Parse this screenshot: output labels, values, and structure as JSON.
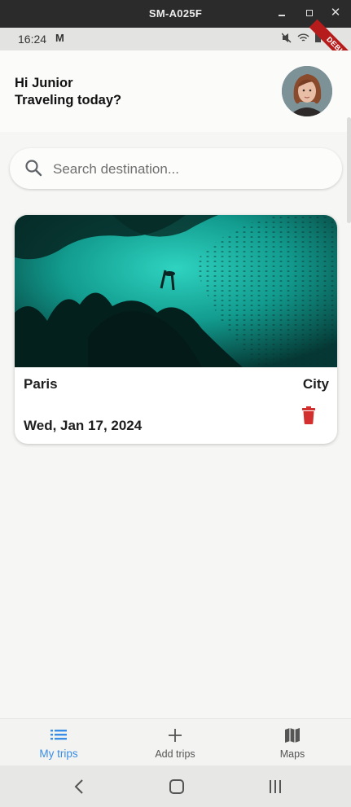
{
  "window": {
    "title": "SM-A025F"
  },
  "status_bar": {
    "time": "16:24",
    "mail_icon": "M",
    "debug_label": "DEBUG"
  },
  "header": {
    "greeting_line1": "Hi Junior",
    "greeting_line2": "Traveling today?"
  },
  "search": {
    "placeholder": "Search destination..."
  },
  "trips": [
    {
      "city": "Paris",
      "type": "City",
      "date": "Wed, Jan 17, 2024"
    }
  ],
  "bottom_nav": {
    "items": [
      {
        "label": "My trips",
        "icon": "list-icon",
        "active": true
      },
      {
        "label": "Add trips",
        "icon": "plus-icon",
        "active": false
      },
      {
        "label": "Maps",
        "icon": "map-icon",
        "active": false
      }
    ]
  },
  "colors": {
    "accent": "#3a8ee6",
    "delete": "#d32f2f",
    "debug_banner": "#b71c1c"
  }
}
